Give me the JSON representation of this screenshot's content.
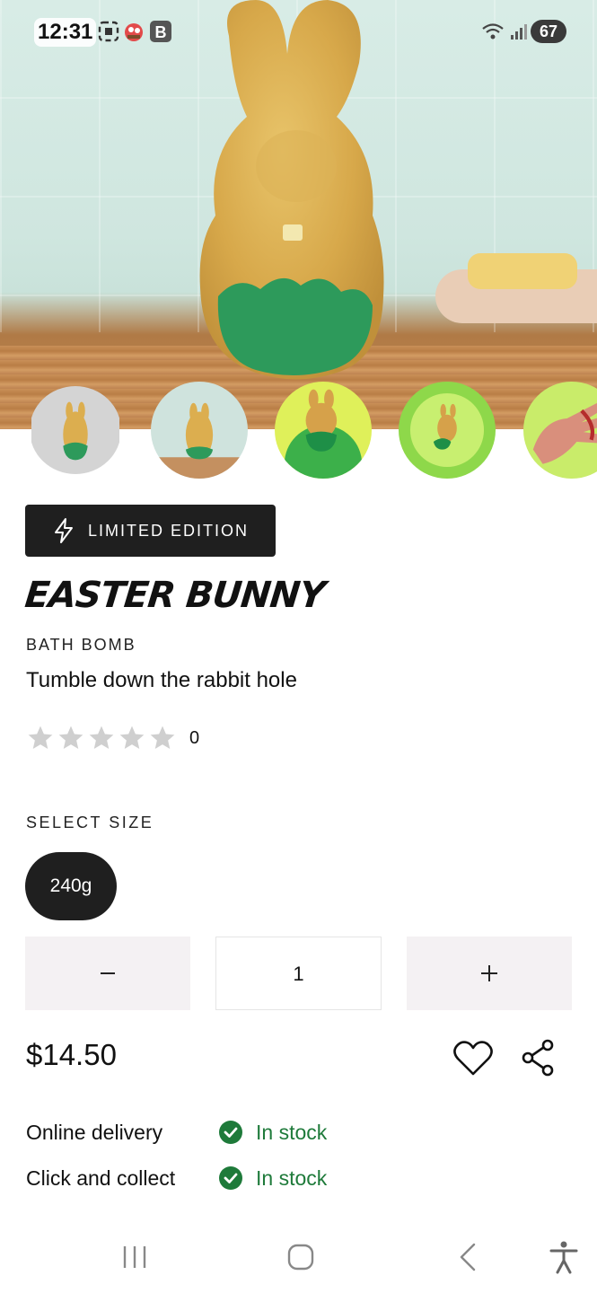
{
  "status_bar": {
    "time": "12:31",
    "battery": "67",
    "icons": [
      "screenshot-icon",
      "app-notification-icon",
      "b-badge-icon",
      "wifi-icon",
      "signal-icon"
    ]
  },
  "product": {
    "badge": "LIMITED EDITION",
    "title": "EASTER BUNNY",
    "category": "BATH BOMB",
    "tagline": "Tumble down the rabbit hole",
    "rating": 0,
    "review_count": "0",
    "size_label": "SELECT SIZE",
    "selected_size": "240g",
    "quantity": "1",
    "price": "$14.50"
  },
  "availability": [
    {
      "label": "Online delivery",
      "status": "In stock"
    },
    {
      "label": "Click and collect",
      "status": "In stock"
    }
  ],
  "colors": {
    "dark": "#1f1f1f",
    "in_stock": "#1e7a3a",
    "qty_button_bg": "#f4f1f3",
    "star_empty": "#cfcfcf"
  },
  "nav_bar": {
    "icons": [
      "recent-apps-icon",
      "home-icon",
      "back-icon",
      "accessibility-icon"
    ]
  }
}
